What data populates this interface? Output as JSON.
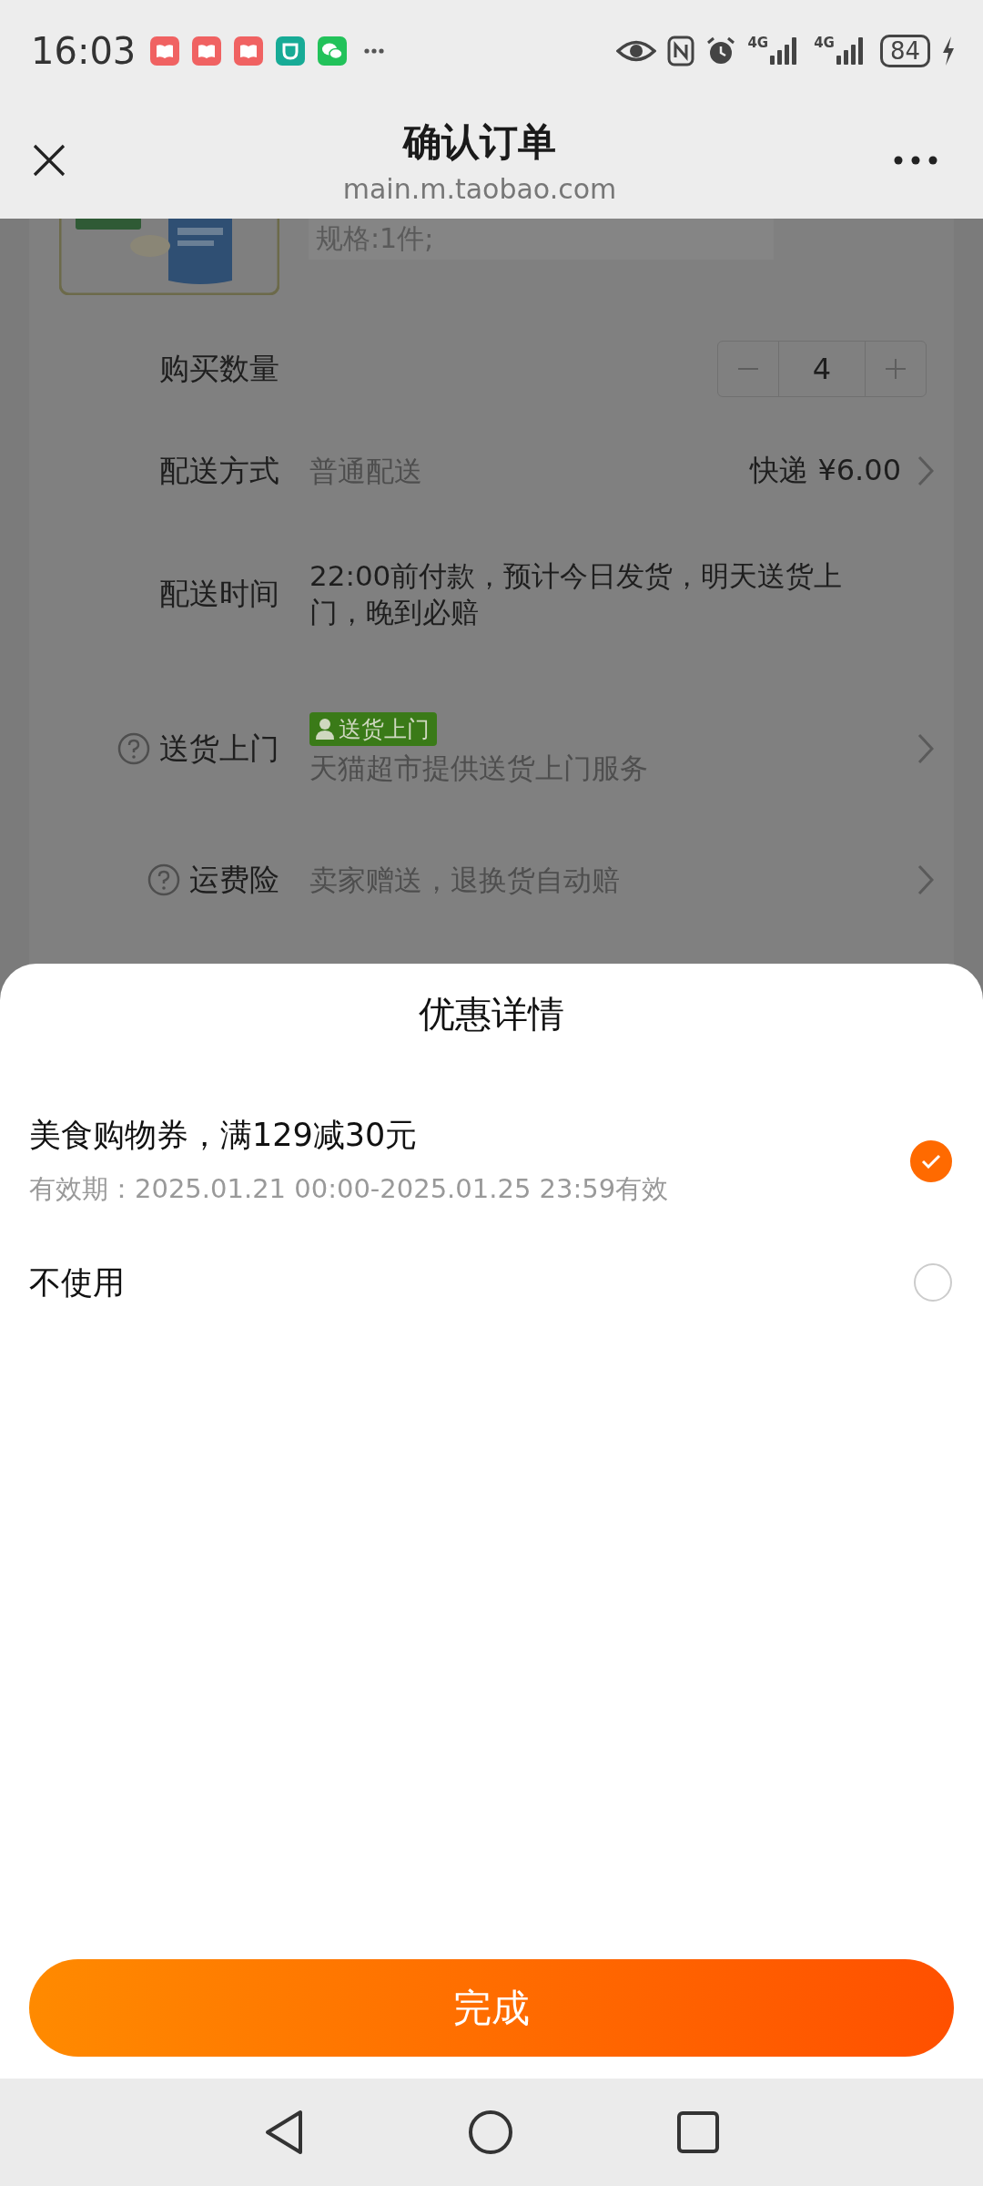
{
  "status_bar": {
    "time": "16:03",
    "signals": [
      {
        "label": "4G"
      },
      {
        "label": "4G"
      }
    ],
    "battery": "84"
  },
  "header": {
    "title": "确认订单",
    "url": "main.m.taobao.com"
  },
  "order": {
    "product": {
      "kind": "picture",
      "spec": "规格:1件;"
    },
    "rows": [
      {
        "kind": "quantity",
        "label": "购买数量",
        "value": "4"
      },
      {
        "kind": "detail",
        "help": false,
        "label": "配送方式",
        "value": "普通配送",
        "extra": "快递 ¥6.00",
        "arrow": true
      },
      {
        "kind": "detail",
        "help": false,
        "label": "配送时间",
        "value": "22:00前付款，预计今日发货，明天送货上门，晚到必赔",
        "arrow": false
      },
      {
        "kind": "detail",
        "help": true,
        "label": "送货上门",
        "tag": "送货上门",
        "value": "天猫超市提供送货上门服务",
        "arrow": true
      },
      {
        "kind": "detail",
        "help": true,
        "label": "运费险",
        "value": "卖家赠送，退换货自动赔",
        "arrow": true
      }
    ]
  },
  "sheet": {
    "title": "优惠详情",
    "options": [
      {
        "title": "美食购物券，满129减30元",
        "subtitle": "有效期：2025.01.21 00:00-2025.01.25 23:59有效",
        "selected": true
      },
      {
        "title": "不使用",
        "selected": false
      }
    ],
    "button": "完成"
  }
}
